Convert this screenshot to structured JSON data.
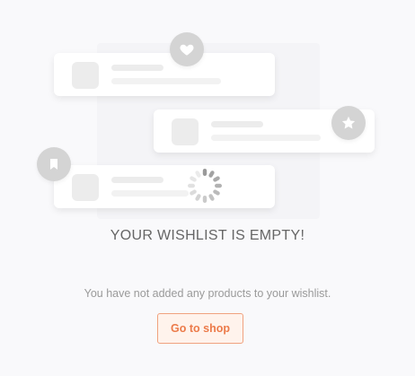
{
  "empty_state": {
    "title": "YOUR WISHLIST IS EMPTY!",
    "message": "You have not added any products to your wishlist.",
    "cta_label": "Go to shop"
  },
  "illustration": {
    "badges": [
      "heart-icon",
      "star-icon",
      "bookmark-icon"
    ],
    "accent_color": "#ec7b4a",
    "badge_color": "#d4d4d4",
    "card_color": "#ffffff"
  }
}
